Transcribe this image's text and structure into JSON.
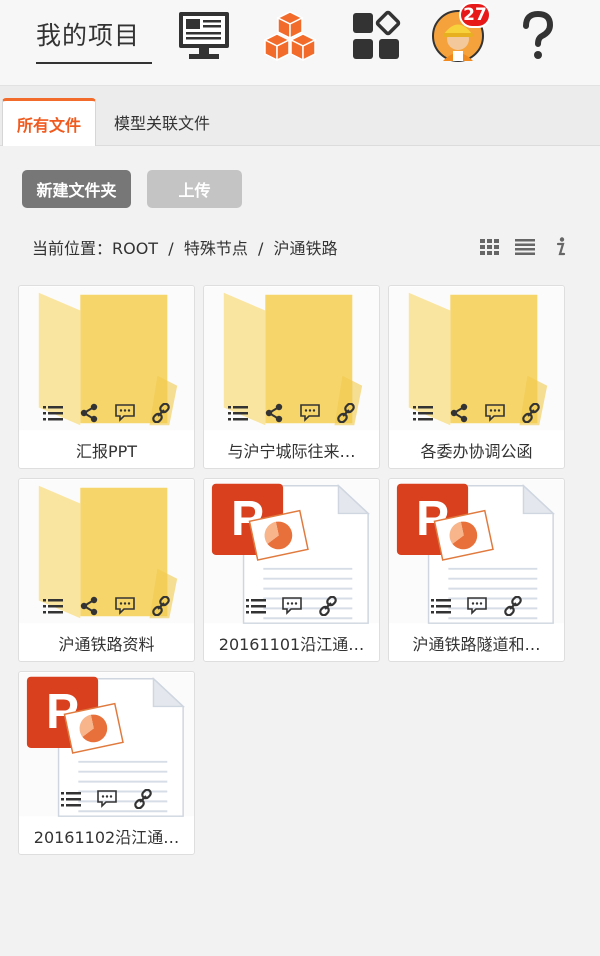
{
  "header": {
    "title": "我的项目",
    "icons": [
      "dashboard-monitor-icon",
      "model-cubes-icon",
      "apps-grid-icon",
      "user-avatar",
      "help-icon"
    ],
    "notification_count": "27"
  },
  "tabs": [
    {
      "label": "所有文件",
      "active": true
    },
    {
      "label": "模型关联文件",
      "active": false
    }
  ],
  "toolbar": {
    "new_folder_label": "新建文件夹",
    "upload_label": "上传"
  },
  "breadcrumb": {
    "text": "当前位置：ROOT  /  特殊节点  /  沪通铁路"
  },
  "view_icons": [
    "grid-view-icon",
    "list-view-icon",
    "info-icon"
  ],
  "files": [
    {
      "name": "汇报PPT",
      "type": "folder"
    },
    {
      "name": "与沪宁城际往来…",
      "type": "folder"
    },
    {
      "name": "各委办协调公函",
      "type": "folder"
    },
    {
      "name": "沪通铁路资料",
      "type": "folder"
    },
    {
      "name": "20161101沿江通…",
      "type": "ppt"
    },
    {
      "name": "沪通铁路隧道和…",
      "type": "ppt"
    },
    {
      "name": "20161102沿江通…",
      "type": "ppt"
    }
  ],
  "colors": {
    "accent": "#f05a1e",
    "folder": "#f8dc7a",
    "ppt_red": "#d9411e"
  }
}
